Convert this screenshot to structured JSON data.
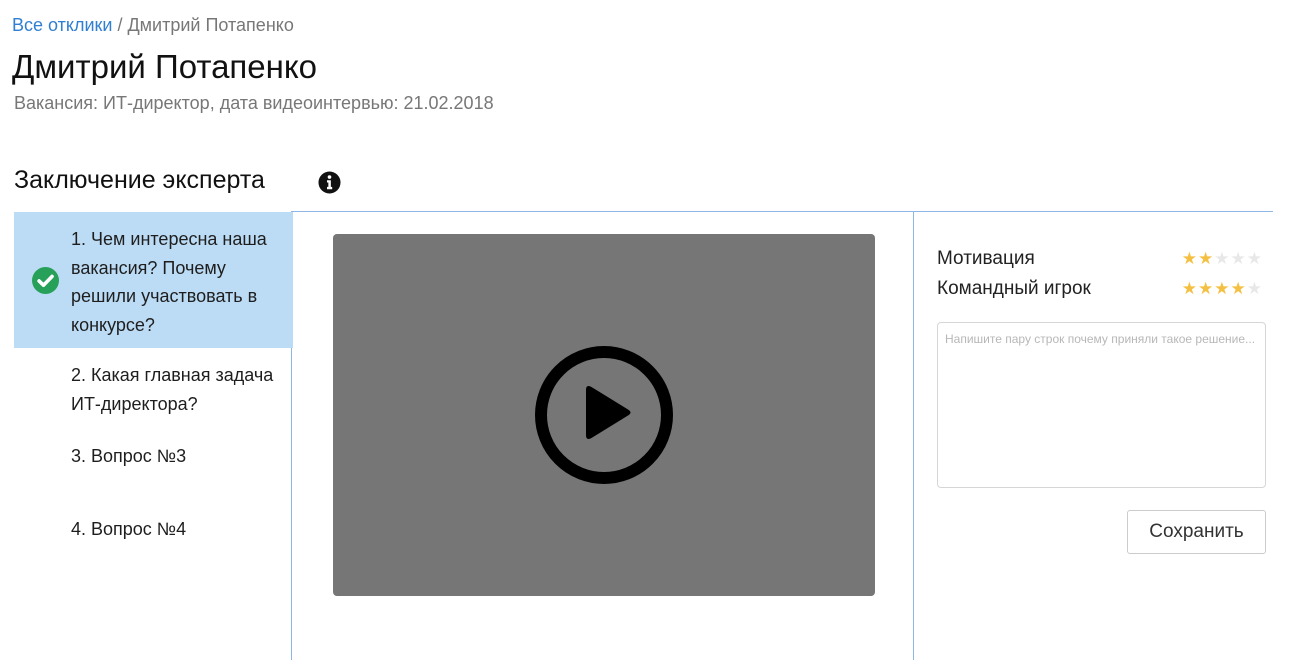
{
  "breadcrumb": {
    "link": "Все отклики",
    "separator": " / ",
    "current": "Дмитрий Потапенко"
  },
  "candidate": {
    "name": "Дмитрий Потапенко",
    "details": "Вакансия: ИТ-директор, дата видеоинтервью: 21.02.2018"
  },
  "section": {
    "title": "Заключение эксперта",
    "info_icon": "info-circle-icon"
  },
  "questions": [
    {
      "label": "1. Чем интересна наша вакансия? Почему решили участвовать в конкурсе?",
      "answered": true,
      "active": true
    },
    {
      "label": "2. Какая главная задача ИТ-директора?",
      "answered": false,
      "active": false
    },
    {
      "label": "3. Вопрос №3",
      "answered": false,
      "active": false
    },
    {
      "label": "4. Вопрос №4",
      "answered": false,
      "active": false
    }
  ],
  "video": {
    "icon": "play-icon"
  },
  "ratings": [
    {
      "label": "Мотивация",
      "value": 2,
      "max": 5
    },
    {
      "label": "Командный игрок",
      "value": 4,
      "max": 5
    }
  ],
  "comment": {
    "placeholder": "Напишите пару строк почему приняли такое решение...",
    "value": ""
  },
  "save_label": "Сохранить",
  "colors": {
    "link": "#2f7fd2",
    "active_question": "#bcdcf5",
    "check": "#27a05a",
    "star_on": "#f4c041",
    "star_off": "#e8e8e8",
    "video_bg": "#767676",
    "divider": "#8fb7e6"
  }
}
